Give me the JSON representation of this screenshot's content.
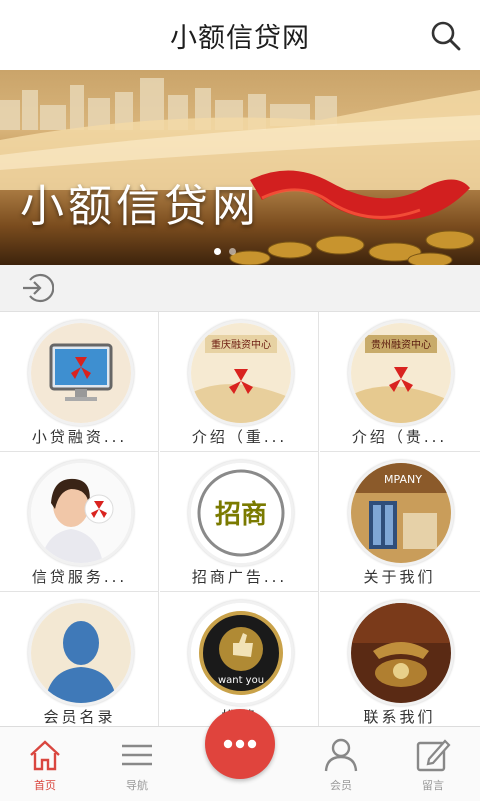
{
  "header": {
    "title": "小额信贷网",
    "search_icon": "search-icon"
  },
  "banner": {
    "title": "小额信贷网",
    "slide_count": 2,
    "active_slide": 0
  },
  "grid": {
    "items": [
      {
        "label": "小贷融资...",
        "image": "monitor-logo-image"
      },
      {
        "label": "介绍（重...",
        "image": "chongqing-center-image",
        "image_text": "重庆融资中心"
      },
      {
        "label": "介绍（贵...",
        "image": "guizhou-center-image",
        "image_text": "贵州融资中心"
      },
      {
        "label": "信贷服务...",
        "image": "woman-logo-image"
      },
      {
        "label": "招商广告...",
        "image": "zhaoshang-image",
        "image_text": "招商"
      },
      {
        "label": "关于我们",
        "image": "company-image",
        "image_text": "MPANY"
      },
      {
        "label": "会员名录",
        "image": "member-silhouette-image"
      },
      {
        "label": "推荐",
        "image": "want-you-badge-image",
        "image_text": "want you"
      },
      {
        "label": "联系我们",
        "image": "telephone-image"
      }
    ]
  },
  "tabbar": {
    "home": "首页",
    "nav": "导航",
    "member": "会员",
    "message": "留言"
  },
  "colors": {
    "accent": "#e0443d",
    "tab_active": "#d9463f"
  }
}
